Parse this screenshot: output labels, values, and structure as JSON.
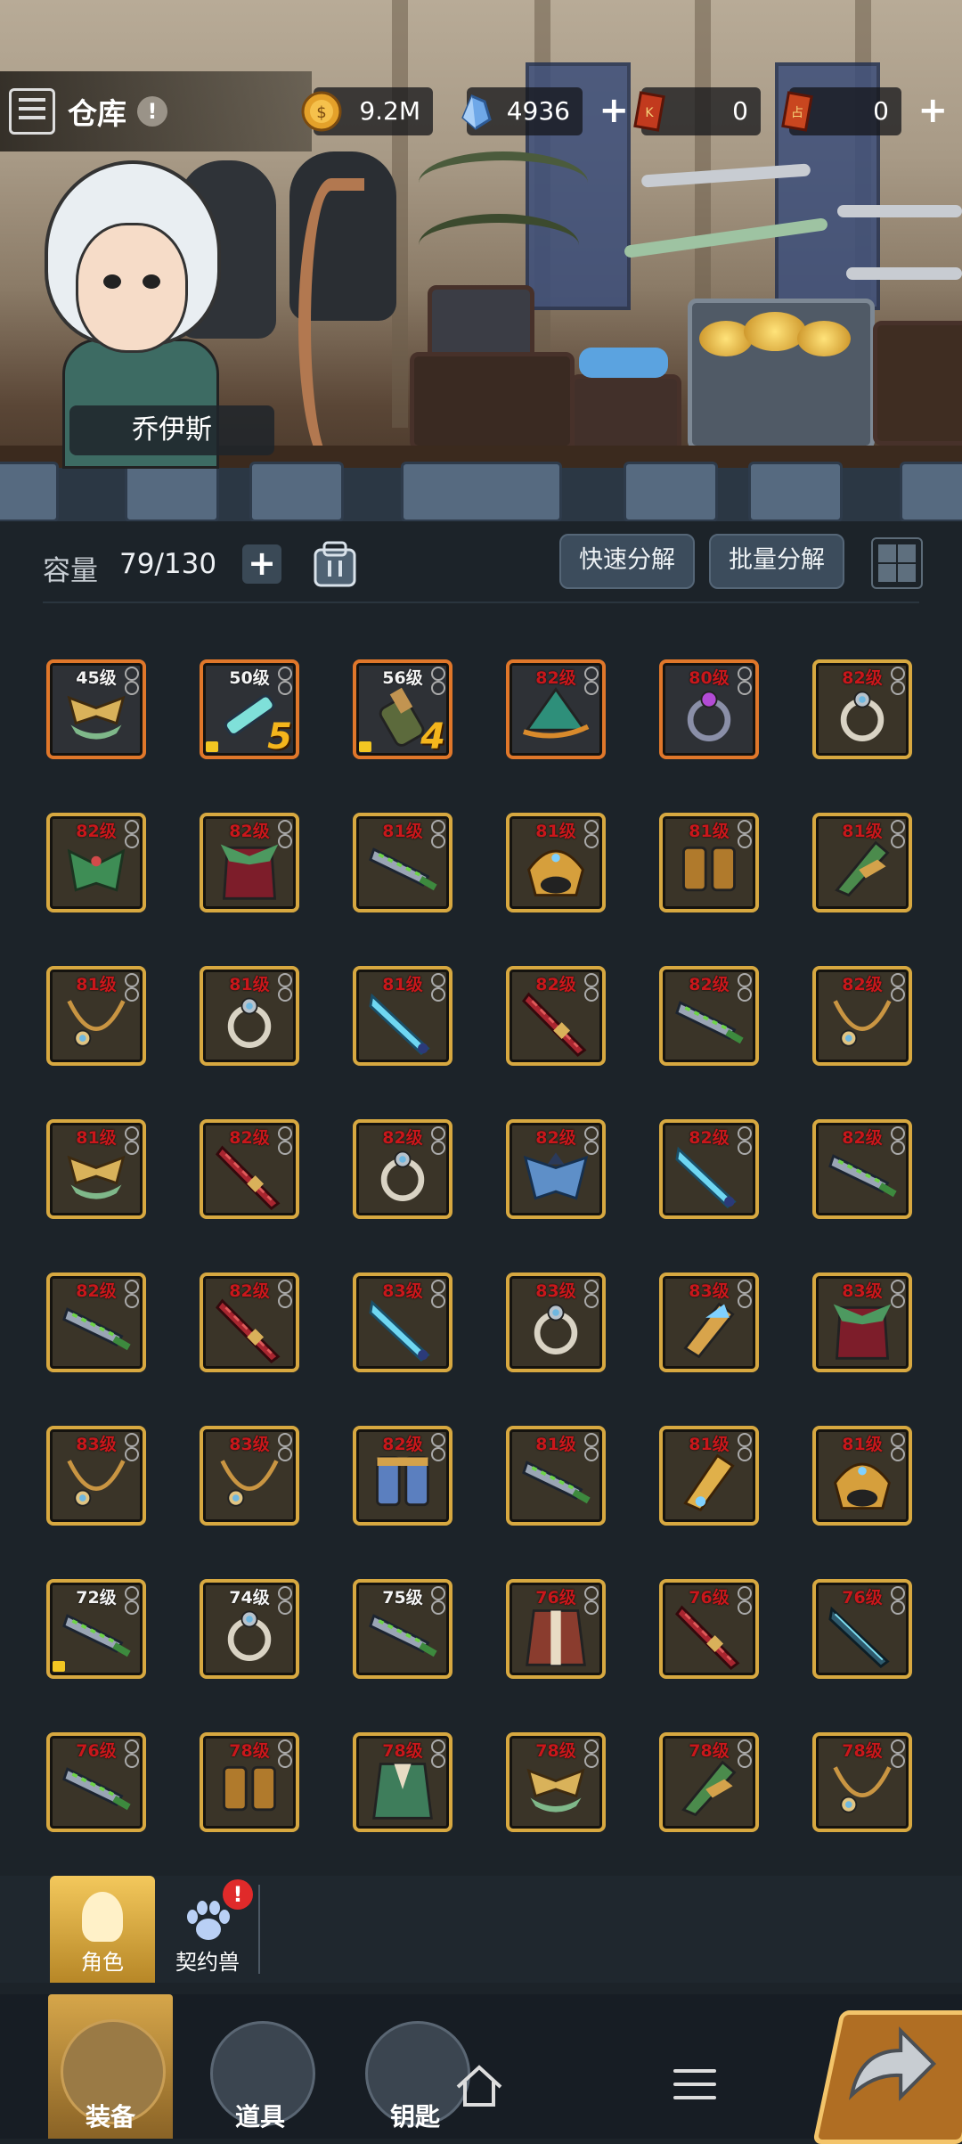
{
  "header": {
    "title": "仓库",
    "info_badge": "!",
    "resources": [
      {
        "name": "gold",
        "icon": "gold-coin-icon",
        "value": "9.2M",
        "has_plus": false
      },
      {
        "name": "crystal",
        "icon": "crystal-icon",
        "value": "4936",
        "has_plus": true
      },
      {
        "name": "ticket-a",
        "icon": "ticket-icon",
        "value": "0",
        "has_plus": false
      },
      {
        "name": "ticket-b",
        "icon": "scroll-ticket-icon",
        "value": "0",
        "has_plus": true
      }
    ]
  },
  "hero": {
    "name": "乔伊斯"
  },
  "toolbar": {
    "capacity_label": "容量",
    "capacity_value": "79/130",
    "quick_decompose": "快速分解",
    "batch_decompose": "批量分解"
  },
  "items": [
    {
      "level": "45级",
      "type": "wings",
      "quality": "orange",
      "over": false
    },
    {
      "level": "50级",
      "type": "cyan-sword",
      "quality": "orange",
      "over": false,
      "locked": true,
      "star": "5"
    },
    {
      "level": "56级",
      "type": "bracer",
      "quality": "orange",
      "over": false,
      "locked": true,
      "star": "4"
    },
    {
      "level": "82级",
      "type": "leaf-hat",
      "quality": "orange",
      "over": true
    },
    {
      "level": "80级",
      "type": "purple-ring",
      "quality": "orange",
      "over": true
    },
    {
      "level": "82级",
      "type": "ring",
      "quality": "gold",
      "over": true
    },
    {
      "level": "82级",
      "type": "leaf-armor",
      "quality": "gold",
      "over": true
    },
    {
      "level": "82级",
      "type": "cloak",
      "quality": "gold",
      "over": true
    },
    {
      "level": "81级",
      "type": "greatsword",
      "quality": "gold",
      "over": true
    },
    {
      "level": "81级",
      "type": "gold-helm",
      "quality": "gold",
      "over": true
    },
    {
      "level": "81级",
      "type": "boots",
      "quality": "gold",
      "over": true
    },
    {
      "level": "81级",
      "type": "leaf-bracer",
      "quality": "gold",
      "over": true
    },
    {
      "level": "81级",
      "type": "necklace",
      "quality": "gold",
      "over": true
    },
    {
      "level": "81级",
      "type": "ring",
      "quality": "gold",
      "over": true
    },
    {
      "level": "81级",
      "type": "ice-sword",
      "quality": "gold",
      "over": true
    },
    {
      "level": "82级",
      "type": "red-blade",
      "quality": "gold",
      "over": true
    },
    {
      "level": "82级",
      "type": "greatsword",
      "quality": "gold",
      "over": true
    },
    {
      "level": "82级",
      "type": "necklace",
      "quality": "gold",
      "over": true
    },
    {
      "level": "81级",
      "type": "wings",
      "quality": "gold",
      "over": true
    },
    {
      "level": "82级",
      "type": "red-blade",
      "quality": "gold",
      "over": true
    },
    {
      "level": "82级",
      "type": "ring",
      "quality": "gold",
      "over": true
    },
    {
      "level": "82级",
      "type": "blue-armor",
      "quality": "gold",
      "over": true
    },
    {
      "level": "82级",
      "type": "ice-sword",
      "quality": "gold",
      "over": true
    },
    {
      "level": "82级",
      "type": "greatsword",
      "quality": "gold",
      "over": true
    },
    {
      "level": "82级",
      "type": "greatsword",
      "quality": "gold",
      "over": true
    },
    {
      "level": "82级",
      "type": "red-blade",
      "quality": "gold",
      "over": true
    },
    {
      "level": "83级",
      "type": "ice-sword",
      "quality": "gold",
      "over": true
    },
    {
      "level": "83级",
      "type": "ring",
      "quality": "gold",
      "over": true
    },
    {
      "level": "83级",
      "type": "ice-bracer",
      "quality": "gold",
      "over": true
    },
    {
      "level": "83级",
      "type": "cloak",
      "quality": "gold",
      "over": true
    },
    {
      "level": "83级",
      "type": "necklace",
      "quality": "gold",
      "over": true
    },
    {
      "level": "83级",
      "type": "necklace",
      "quality": "gold",
      "over": true
    },
    {
      "level": "82级",
      "type": "blue-boots",
      "quality": "gold",
      "over": true
    },
    {
      "level": "81级",
      "type": "greatsword",
      "quality": "gold",
      "over": true
    },
    {
      "level": "81级",
      "type": "gold-bracer",
      "quality": "gold",
      "over": true
    },
    {
      "level": "81级",
      "type": "gold-helm",
      "quality": "gold",
      "over": true
    },
    {
      "level": "72级",
      "type": "greatsword",
      "quality": "gold",
      "over": false,
      "locked": true
    },
    {
      "level": "74级",
      "type": "ring",
      "quality": "gold",
      "over": false
    },
    {
      "level": "75级",
      "type": "greatsword",
      "quality": "gold",
      "over": false
    },
    {
      "level": "76级",
      "type": "robe",
      "quality": "gold",
      "over": true
    },
    {
      "level": "76级",
      "type": "red-blade",
      "quality": "gold",
      "over": true
    },
    {
      "level": "76级",
      "type": "dark-sword",
      "quality": "gold",
      "over": true
    },
    {
      "level": "76级",
      "type": "greatsword",
      "quality": "gold",
      "over": true
    },
    {
      "level": "78级",
      "type": "boots",
      "quality": "gold",
      "over": true
    },
    {
      "level": "78级",
      "type": "green-robe",
      "quality": "gold",
      "over": true
    },
    {
      "level": "78级",
      "type": "wings",
      "quality": "gold",
      "over": true
    },
    {
      "level": "78级",
      "type": "leaf-bracer",
      "quality": "gold",
      "over": true
    },
    {
      "level": "78级",
      "type": "necklace",
      "quality": "gold",
      "over": true
    }
  ],
  "subtabs": [
    {
      "label": "角色",
      "active": true
    },
    {
      "label": "契约兽",
      "alert": "!"
    }
  ],
  "nav": [
    {
      "label": "装备"
    },
    {
      "label": "道具"
    },
    {
      "label": "钥匙"
    }
  ],
  "colors": {
    "background": "#1c2329",
    "quality_gold": "#d7a840",
    "quality_orange": "#e0772a",
    "over_level_text": "#c9171b"
  }
}
